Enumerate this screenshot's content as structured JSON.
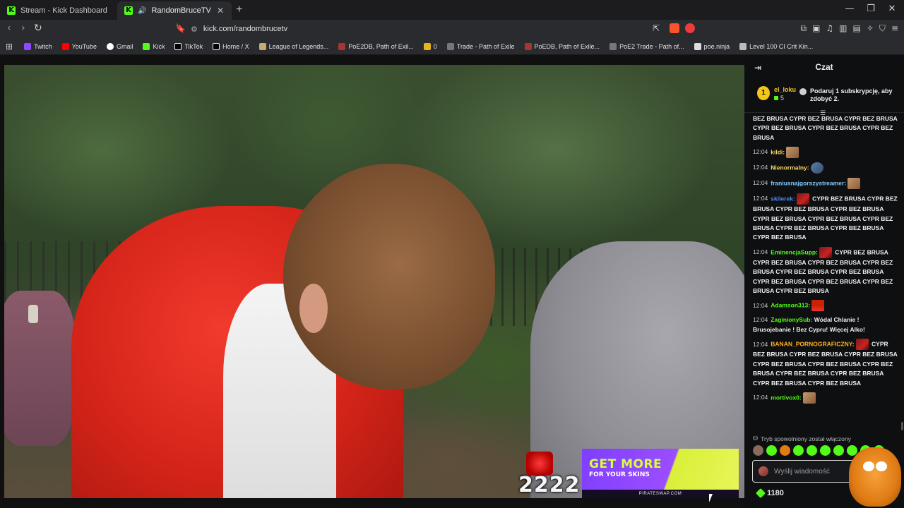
{
  "browser": {
    "tabs": [
      {
        "label": "Stream - Kick Dashboard",
        "active": false
      },
      {
        "label": "RandomBruceTV Stream - Wa",
        "active": true
      }
    ],
    "new_tab": "+",
    "window_controls": [
      "—",
      "❐",
      "✕"
    ],
    "url": "kick.com/randombrucetv",
    "bookmarks": [
      {
        "label": "Twitch",
        "color": "#9146ff"
      },
      {
        "label": "YouTube",
        "color": "#ff0000"
      },
      {
        "label": "Gmail",
        "color": "#ffffff"
      },
      {
        "label": "Kick",
        "color": "#53fc18"
      },
      {
        "label": "TikTok",
        "color": "#ffffff"
      },
      {
        "label": "Home / X",
        "color": "#ffffff"
      },
      {
        "label": "League of Legends...",
        "color": "#c8aa6e"
      },
      {
        "label": "PoE2DB, Path of Exil...",
        "color": "#a33"
      },
      {
        "label": "0",
        "color": "#e6b422"
      },
      {
        "label": "Trade - Path of Exile",
        "color": "#777"
      },
      {
        "label": "PoEDB, Path of Exile...",
        "color": "#a33"
      },
      {
        "label": "PoE2 Trade - Path of...",
        "color": "#777"
      },
      {
        "label": "poe.ninja",
        "color": "#ddd"
      },
      {
        "label": "Level 100 CI Crit Kin...",
        "color": "#bbb"
      }
    ]
  },
  "stream": {
    "overlay_counter": "2222",
    "ad": {
      "line1": "GET MORE",
      "line2": "FOR YOUR SKINS",
      "url": "PIRATESWAP.COM"
    }
  },
  "chat": {
    "title": "Czat",
    "pinned": {
      "badge": "1",
      "user": "el_loku",
      "count": "5",
      "cta": "Podaruj 1 subskrypcję, aby zdobyć 2."
    },
    "messages": [
      {
        "time": "",
        "user": "",
        "user_color": "#ffffff",
        "text": "BEZ BRUSA  CYPR BEZ BRUSA  CYPR BEZ BRUSA  CYPR BEZ BRUSA  CYPR BEZ BRUSA  CYPR BEZ BRUSA",
        "emote": "none"
      },
      {
        "time": "12:04",
        "user": "kildi:",
        "user_color": "#ffd966",
        "text": "",
        "emote": "face"
      },
      {
        "time": "12:04",
        "user": "Nienormalny:",
        "user_color": "#ffd966",
        "text": "",
        "emote": "blue"
      },
      {
        "time": "12:04",
        "user": "franiusnajgorszystreamer:",
        "user_color": "#7ec8ff",
        "text": "",
        "emote": "face"
      },
      {
        "time": "12:04",
        "user": "skilerek:",
        "user_color": "#4f8cff",
        "text": "CYPR BEZ BRUSA  CYPR BEZ BRUSA  CYPR BEZ BRUSA  CYPR BEZ BRUSA  CYPR BEZ BRUSA  CYPR BEZ BRUSA  CYPR BEZ BRUSA  CYPR BEZ BRUSA  CYPR BEZ BRUSA  CYPR BEZ BRUSA",
        "emote": "red"
      },
      {
        "time": "12:04",
        "user": "EminencjaSupp:",
        "user_color": "#53fc18",
        "text": "CYPR BEZ BRUSA  CYPR BEZ BRUSA  CYPR BEZ BRUSA  CYPR BEZ BRUSA  CYPR BEZ BRUSA  CYPR BEZ BRUSA  CYPR BEZ BRUSA  CYPR BEZ BRUSA  CYPR BEZ BRUSA  CYPR BEZ BRUSA",
        "emote": "red"
      },
      {
        "time": "12:04",
        "user": "Adamson313:",
        "user_color": "#53fc18",
        "text": "",
        "emote": "flag"
      },
      {
        "time": "12:04",
        "user": "ZaginionySub:",
        "user_color": "#53fc18",
        "text": "Wódal Chlanie ! Brusojebanie ! Bez Cypru! Więcej Alko!",
        "emote": "none"
      },
      {
        "time": "12:04",
        "user": "BANAN_PORNOGRAFICZNY:",
        "user_color": "#ffb020",
        "text": "CYPR BEZ BRUSA  CYPR BEZ BRUSA  CYPR BEZ BRUSA  CYPR BEZ BRUSA  CYPR BEZ BRUSA  CYPR BEZ BRUSA  CYPR BEZ BRUSA  CYPR BEZ BRUSA  CYPR BEZ BRUSA  CYPR BEZ BRUSA",
        "emote": "red"
      },
      {
        "time": "12:04",
        "user": "mortivox0:",
        "user_color": "#53fc18",
        "text": "",
        "emote": "face"
      }
    ],
    "slow_mode": "Tryb spowolniony został włączony",
    "input_placeholder": "Wyślij wiadomość",
    "points": "1180",
    "emote_bar_colors": [
      "#8a6a5a",
      "#53fc18",
      "#e07b15",
      "#53fc18",
      "#53fc18",
      "#53fc18",
      "#53fc18",
      "#53fc18",
      "#53fc18",
      "#53fc18"
    ]
  }
}
